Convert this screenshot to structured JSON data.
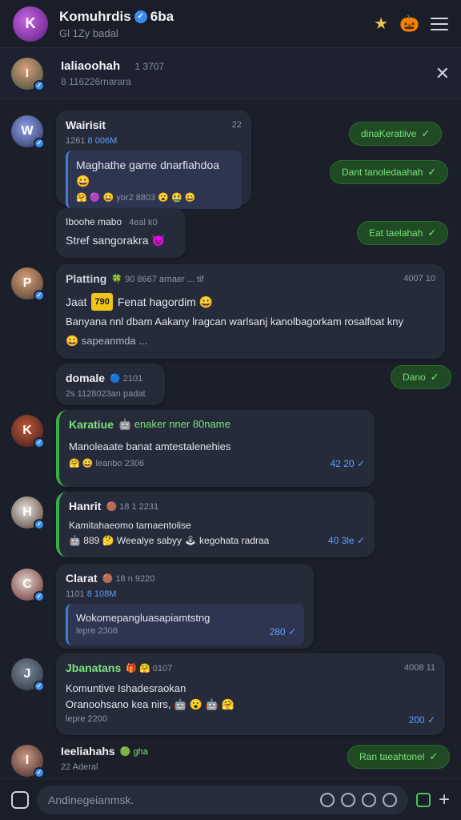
{
  "header": {
    "title": "Komuhrdis",
    "title_suffix": "6ba",
    "subtitle": "Gl 1Zy badal",
    "star_icon": "★",
    "pumpkin_icon": "🎃"
  },
  "pinned": {
    "title": "Ialiaoohah",
    "meta": "1 3707",
    "subtitle": "8 116226rnarara",
    "close": "✕"
  },
  "messages": [
    {
      "author": "Wairisit",
      "meta": "22",
      "line1": "1261",
      "link1": "8 006M",
      "quote": "Maghathe game dnarfiahdoa 😀",
      "quote_line2": "🤗 🟣 😀   yor2 8803   😮 🤮 😀",
      "quote2_author": "Iboohe mabo",
      "quote2_meta": "4eal k0",
      "quote2_text": "Stref sangorakra 😈"
    },
    {
      "author": "Platting",
      "meta": "🍀 90 8667 arnaer ... tif",
      "time": "4007 10",
      "tag_a": "Jaat",
      "tag_b": "790",
      "head": "Fenat hagordim 😀",
      "body": "Banyana nnl dbam Aakany lragcan warlsanj kanolbagorkam rosalfoat kny",
      "foot": "😀 sapeanmda ..."
    },
    {
      "author": "domale",
      "meta": "🔵 2101",
      "sub": "2s 1128023an padat"
    },
    {
      "author": "Karatiue",
      "meta": "🤖 enaker nner 80name",
      "text": "Manoleaate banat amtestalenehies",
      "foot": "🤗 😀 leanbo 2306",
      "time": "42 20"
    },
    {
      "author": "Hanrit",
      "meta": "🟤 18 1 2231",
      "text": "Kamitahaeomo tarnaentolise",
      "row": "🤖 889 🤔 Weealye sabyy 🕹 kegohata radraa",
      "time": "40 3le"
    },
    {
      "author": "Clarat",
      "meta": "🟤 18 n 9220",
      "line1": "1101",
      "link1": "8 108M",
      "quote": "Wokomepangluasapiamtstng",
      "foot": "lepre 2308",
      "time": "280"
    },
    {
      "author": "Jbanatans",
      "meta": "🎁 🤗 0107",
      "time": "4008 11",
      "text1": "Komuntive Ishadesraokan",
      "text2": "Oranoohsano kea nirs, 🤖 😮 🤖 🤗",
      "foot": "lepre 2200",
      "time2": "200"
    },
    {
      "author": "Ieeliahahs",
      "meta": "🟢 gha",
      "sub": "22 Aderal"
    }
  ],
  "outgoing": [
    {
      "text": "dinaKeratiive"
    },
    {
      "text": "Dant tanoledaahah"
    },
    {
      "text": "Eat taelahah"
    },
    {
      "text": "Dano"
    },
    {
      "text": "Ran taeahtonel"
    }
  ],
  "composer": {
    "placeholder": "Andinegeianmsk."
  }
}
